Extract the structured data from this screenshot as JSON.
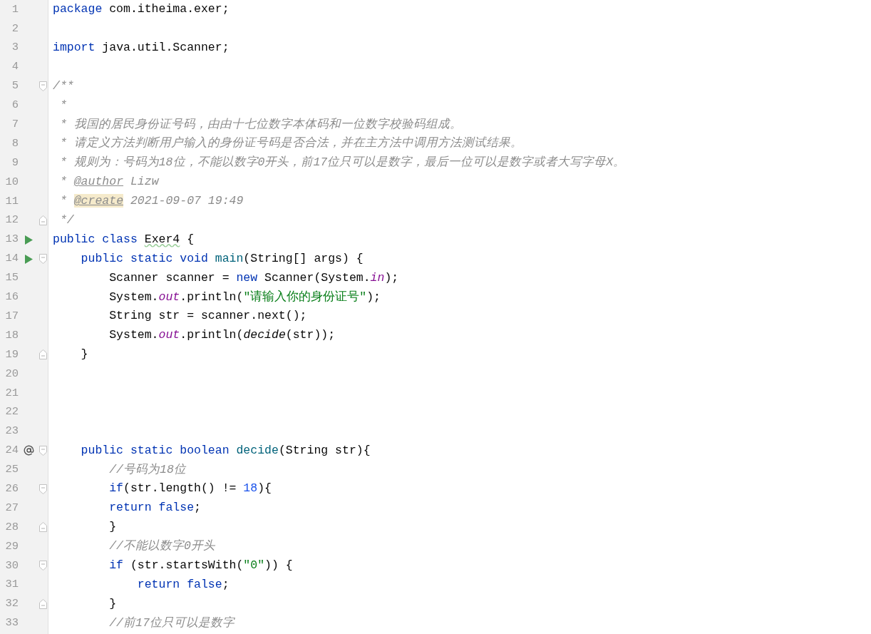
{
  "editor": {
    "lines": [
      {
        "number": "1",
        "tokens": [
          {
            "text": "package",
            "kind": "keyword"
          },
          {
            "text": " com.itheima.exer;",
            "kind": "plain"
          }
        ]
      },
      {
        "number": "2"
      },
      {
        "number": "3",
        "tokens": [
          {
            "text": "import",
            "kind": "keyword"
          },
          {
            "text": " java.util.Scanner;",
            "kind": "plain"
          }
        ]
      },
      {
        "number": "4"
      },
      {
        "number": "5",
        "fold_start": true,
        "tokens": [
          {
            "text": "/**",
            "kind": "doc"
          }
        ]
      },
      {
        "number": "6",
        "tokens": [
          {
            "text": " *",
            "kind": "doc"
          }
        ]
      },
      {
        "number": "7",
        "tokens": [
          {
            "text": " * 我国的居民身份证号码，由由十七位数字本体码和一位数字校验码组成。",
            "kind": "doc"
          }
        ]
      },
      {
        "number": "8",
        "tokens": [
          {
            "text": " * 请定义方法判断用户输入的身份证号码是否合法，并在主方法中调用方法测试结果。",
            "kind": "doc"
          }
        ]
      },
      {
        "number": "9",
        "tokens": [
          {
            "text": " * 规则为：号码为18位，不能以数字0开头，前17位只可以是数字，最后一位可以是数字或者大写字母X。",
            "kind": "doc"
          }
        ]
      },
      {
        "number": "10",
        "tokens": [
          {
            "text": " * ",
            "kind": "doc"
          },
          {
            "text": "@author",
            "kind": "doc-tag"
          },
          {
            "text": " Lizw",
            "kind": "doc"
          }
        ]
      },
      {
        "number": "11",
        "tokens": [
          {
            "text": " * ",
            "kind": "doc"
          },
          {
            "text": "@create",
            "kind": "doc-tag-highlighted"
          },
          {
            "text": " 2021-09-07 19:49",
            "kind": "doc"
          }
        ]
      },
      {
        "number": "12",
        "fold_end": true,
        "tokens": [
          {
            "text": " */",
            "kind": "doc"
          }
        ]
      },
      {
        "number": "13",
        "runnable": true,
        "tokens": [
          {
            "text": "public class ",
            "kind": "keyword"
          },
          {
            "text": "Exer4",
            "kind": "typo"
          },
          {
            "text": " {",
            "kind": "plain"
          }
        ]
      },
      {
        "number": "14",
        "runnable": true,
        "fold_start": true,
        "tokens": [
          {
            "text": "    public static void ",
            "kind": "keyword"
          },
          {
            "text": "main",
            "kind": "declaration"
          },
          {
            "text": "(String[] args) {",
            "kind": "plain"
          }
        ]
      },
      {
        "number": "15",
        "tokens": [
          {
            "text": "        Scanner scanner = ",
            "kind": "plain"
          },
          {
            "text": "new",
            "kind": "keyword"
          },
          {
            "text": " Scanner(System.",
            "kind": "plain"
          },
          {
            "text": "in",
            "kind": "field"
          },
          {
            "text": ");",
            "kind": "plain"
          }
        ]
      },
      {
        "number": "16",
        "tokens": [
          {
            "text": "        System.",
            "kind": "plain"
          },
          {
            "text": "out",
            "kind": "field"
          },
          {
            "text": ".println(",
            "kind": "plain"
          },
          {
            "text": "\"请输入你的身份证号\"",
            "kind": "string"
          },
          {
            "text": ");",
            "kind": "plain"
          }
        ]
      },
      {
        "number": "17",
        "tokens": [
          {
            "text": "        String str = scanner.next();",
            "kind": "plain"
          }
        ]
      },
      {
        "number": "18",
        "tokens": [
          {
            "text": "        System.",
            "kind": "plain"
          },
          {
            "text": "out",
            "kind": "field"
          },
          {
            "text": ".println(",
            "kind": "plain"
          },
          {
            "text": "decide",
            "kind": "static-call"
          },
          {
            "text": "(str));",
            "kind": "plain"
          }
        ]
      },
      {
        "number": "19",
        "fold_end": true,
        "tokens": [
          {
            "text": "    }",
            "kind": "plain"
          }
        ]
      },
      {
        "number": "20"
      },
      {
        "number": "21"
      },
      {
        "number": "22"
      },
      {
        "number": "23"
      },
      {
        "number": "24",
        "overrides": true,
        "fold_start": true,
        "tokens": [
          {
            "text": "    public static boolean ",
            "kind": "keyword"
          },
          {
            "text": "decide",
            "kind": "declaration"
          },
          {
            "text": "(String str){",
            "kind": "plain"
          }
        ]
      },
      {
        "number": "25",
        "tokens": [
          {
            "text": "        //号码为18位",
            "kind": "comment"
          }
        ]
      },
      {
        "number": "26",
        "fold_start": true,
        "tokens": [
          {
            "text": "        if",
            "kind": "keyword"
          },
          {
            "text": "(str.length() != ",
            "kind": "plain"
          },
          {
            "text": "18",
            "kind": "number"
          },
          {
            "text": "){",
            "kind": "plain"
          }
        ]
      },
      {
        "number": "27",
        "tokens": [
          {
            "text": "        return false",
            "kind": "keyword"
          },
          {
            "text": ";",
            "kind": "plain"
          }
        ]
      },
      {
        "number": "28",
        "fold_end": true,
        "tokens": [
          {
            "text": "        }",
            "kind": "plain"
          }
        ]
      },
      {
        "number": "29",
        "tokens": [
          {
            "text": "        //不能以数字0开头",
            "kind": "comment"
          }
        ]
      },
      {
        "number": "30",
        "fold_start": true,
        "tokens": [
          {
            "text": "        if",
            "kind": "keyword"
          },
          {
            "text": " (str.startsWith(",
            "kind": "plain"
          },
          {
            "text": "\"0\"",
            "kind": "string"
          },
          {
            "text": ")) {",
            "kind": "plain"
          }
        ]
      },
      {
        "number": "31",
        "tokens": [
          {
            "text": "            return false",
            "kind": "keyword"
          },
          {
            "text": ";",
            "kind": "plain"
          }
        ]
      },
      {
        "number": "32",
        "fold_end": true,
        "tokens": [
          {
            "text": "        }",
            "kind": "plain"
          }
        ]
      },
      {
        "number": "33",
        "tokens": [
          {
            "text": "        //前17位只可以是数字",
            "kind": "comment"
          }
        ]
      }
    ]
  }
}
